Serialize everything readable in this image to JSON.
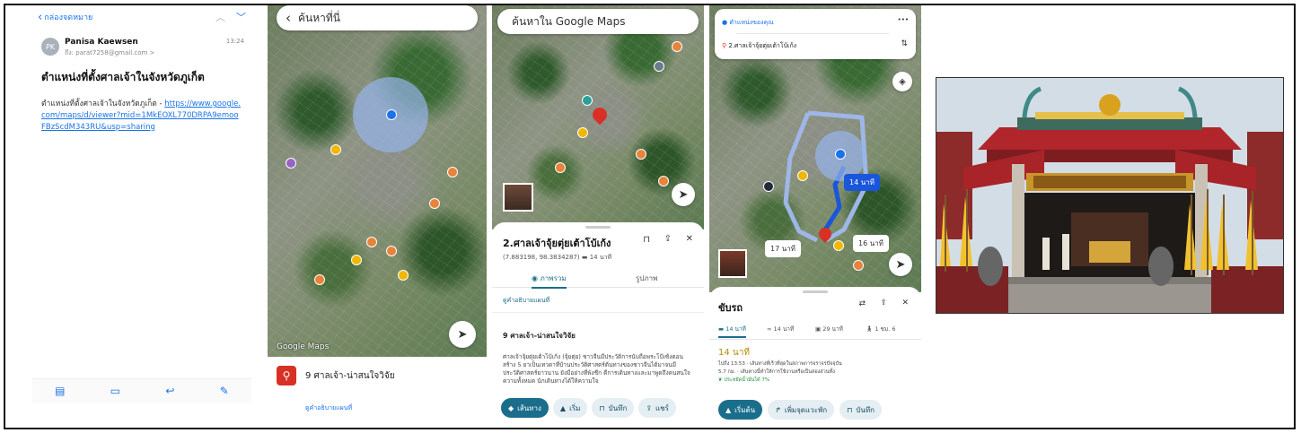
{
  "mail": {
    "back_label": "กล่องจดหมาย",
    "avatar_initials": "PK",
    "sender": "Panisa Kaewsen",
    "time": "13:24",
    "to_prefix": "ถึง:",
    "to_address": "parat7258@gmail.com >",
    "subject": "ตำแหน่งที่ตั้งศาลเจ้าในจังหวัดภูเก็ต",
    "body_text": "ตำแหน่งที่ตั้งศาลเจ้าในจังหวัดภูเก็ต -",
    "link_text": "https://www.google.com/maps/d/viewer?mid=1MkEOXL770DRPA9emooFBzScdM343RU&usp=sharing"
  },
  "map1": {
    "search_text": "ค้นหาที่นี่",
    "watermark": "Google Maps",
    "place_name": "9 ศาลเจ้า-น่าสนใจวิจัย",
    "place_sub": "ดูคำอธิบายแผนที่"
  },
  "map2": {
    "search_text": "ค้นหาใน Google Maps",
    "place_title": "2.ศาลเจ้าจุ้ยตุ่ยเต้าโบ้เก้ง",
    "coords": "(7.883198, 98.3834287)",
    "drive_time": "14 นาที",
    "tab_overview": "ภาพรวม",
    "tab_photos": "รูปภาพ",
    "map_link": "ดูคำอธิบายแผนที่",
    "section_title": "9 ศาลเจ้า-น่าสนใจวิจัย",
    "description": "ศาลเจ้าจุ้ยตุ่ยเต้าโบ้เก้ง (จุ้ยตุ่ย) ชาวจีนมีประวัติการนับถือพระโป้เซ้งตอนสร้าง 5 ยาเป็นเทวดาที่บ้านประวัติศาสตร์ต้นทางของชาวจีนได้มาจนมีประวัติศาสตร์ยาวนาน ยังมีอย่างที่พังชีก ดีการเดินทางและมาพูดถึงคนสนใจความทั้งหมด นักเดินทางได้ให้ความใจ",
    "btn_route": "เส้นทาง",
    "btn_start": "เริ่ม",
    "btn_save": "บันทึก",
    "btn_share": "แชร์"
  },
  "map3": {
    "origin": "ตำแหน่งของคุณ",
    "destination": "2.ศาลเจ้าจุ้ยตุ่ยเต้าโบ้เก้ง",
    "more": "•••",
    "route_label_main": "14 นาที",
    "route_label_alt1": "17 นาที",
    "route_label_alt2": "16 นาที",
    "sheet_title": "ขับรถ",
    "mode_car": "14 นาที",
    "mode_moto": "14 นาที",
    "mode_transit": "29 นาที",
    "mode_walk": "1 ชม. 6",
    "duration": "14 นาที",
    "arrive": "ไปถึง 13:53 · เส้นทางที่เร็วที่สุดในสภาพการจราจรปัจจุบัน",
    "distance": "5.7 กม. · เส้นทางนี้ทำให้การใช้งานหรือเป็นสองส่วนทั้ง",
    "fuel": "ประหยัดน้ำมันได้ 7%",
    "btn_start": "เริ่มต้น",
    "btn_stops": "เพิ่มจุดแวะพัก",
    "btn_save": "บันทึก"
  },
  "colors": {
    "ios_blue": "#1a73e8",
    "maps_red": "#d93025",
    "temple_red": "#b0262b",
    "flag_yellow": "#f2c12e"
  }
}
